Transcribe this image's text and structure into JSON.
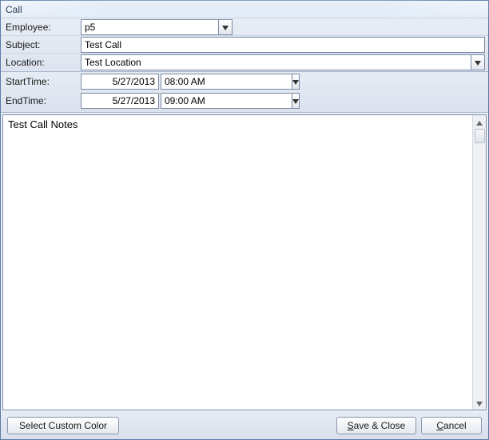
{
  "window": {
    "title": "Call"
  },
  "form": {
    "employee_label": "Employee:",
    "employee_value": "p5",
    "subject_label": "Subject:",
    "subject_value": "Test Call",
    "location_label": "Location:",
    "location_value": "Test Location"
  },
  "time": {
    "start_label": "StartTime:",
    "start_date": "5/27/2013",
    "start_time": "08:00 AM",
    "end_label": "EndTime:",
    "end_date": "5/27/2013",
    "end_time": "09:00 AM"
  },
  "notes": {
    "value": "Test Call Notes"
  },
  "buttons": {
    "custom_color": "Select Custom Color",
    "save_pre": "",
    "save_key": "S",
    "save_post": "ave & Close",
    "cancel_pre": "",
    "cancel_key": "C",
    "cancel_post": "ancel"
  }
}
